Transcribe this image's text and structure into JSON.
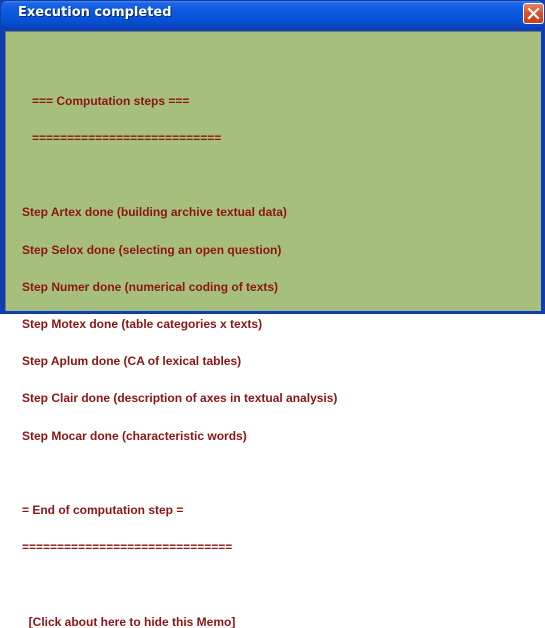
{
  "window": {
    "title": "Execution completed"
  },
  "memo": {
    "header": "   === Computation steps ===",
    "header_rule": "   ===========================",
    "steps": [
      "Step Artex done (building archive textual data)",
      "Step Selox done (selecting an open question)",
      "Step Numer done (numerical coding of texts)",
      "Step Motex done (table categories x texts)",
      "Step Aplum done (CA of lexical tables)",
      "Step Clair done (description of axes in textual analysis)",
      "Step Mocar done (characteristic words)"
    ],
    "footer": "= End of computation step =",
    "footer_rule": "==============================",
    "hide_link": "  [Click about here to hide this Memo]"
  },
  "colors": {
    "memo_background": "#a7bf7d",
    "memo_text": "#8c1414",
    "titlebar": "#0858df"
  },
  "icons": {
    "close": "close-icon"
  }
}
